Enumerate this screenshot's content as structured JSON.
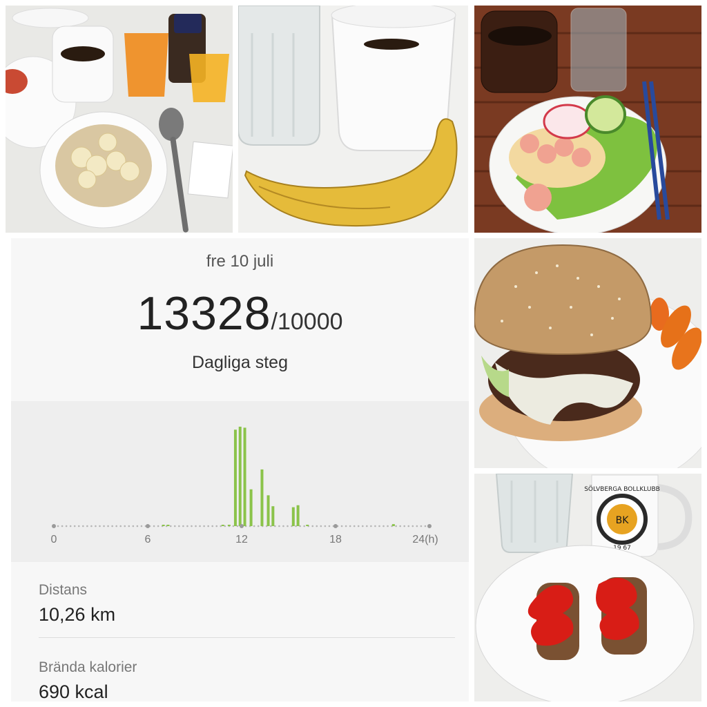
{
  "panel": {
    "date": "fre 10 juli",
    "steps": "13328",
    "goal": "/10000",
    "steps_label": "Dagliga steg",
    "distance_label": "Distans",
    "distance_value": "10,26 km",
    "calories_label": "Brända kalorier",
    "calories_value": "690 kcal"
  },
  "mug_logo": {
    "text": "SÖLVBERGA BOLLKLUBB",
    "year": "19 67",
    "letters": "BK"
  },
  "chart_data": {
    "type": "bar",
    "x_tick_labels": [
      "0",
      "6",
      "12",
      "18",
      "24(h)"
    ],
    "xlim": [
      0,
      24
    ],
    "bar_color": "#8bc34a",
    "bars": [
      {
        "x": 7.0,
        "value": 1
      },
      {
        "x": 7.3,
        "value": 1
      },
      {
        "x": 10.8,
        "value": 1
      },
      {
        "x": 11.2,
        "value": 1
      },
      {
        "x": 11.6,
        "value": 97
      },
      {
        "x": 11.9,
        "value": 100
      },
      {
        "x": 12.2,
        "value": 99
      },
      {
        "x": 12.6,
        "value": 37
      },
      {
        "x": 13.3,
        "value": 57
      },
      {
        "x": 13.7,
        "value": 31
      },
      {
        "x": 14.0,
        "value": 20
      },
      {
        "x": 15.3,
        "value": 19
      },
      {
        "x": 15.6,
        "value": 21
      },
      {
        "x": 16.2,
        "value": 1
      },
      {
        "x": 21.7,
        "value": 2
      }
    ]
  }
}
